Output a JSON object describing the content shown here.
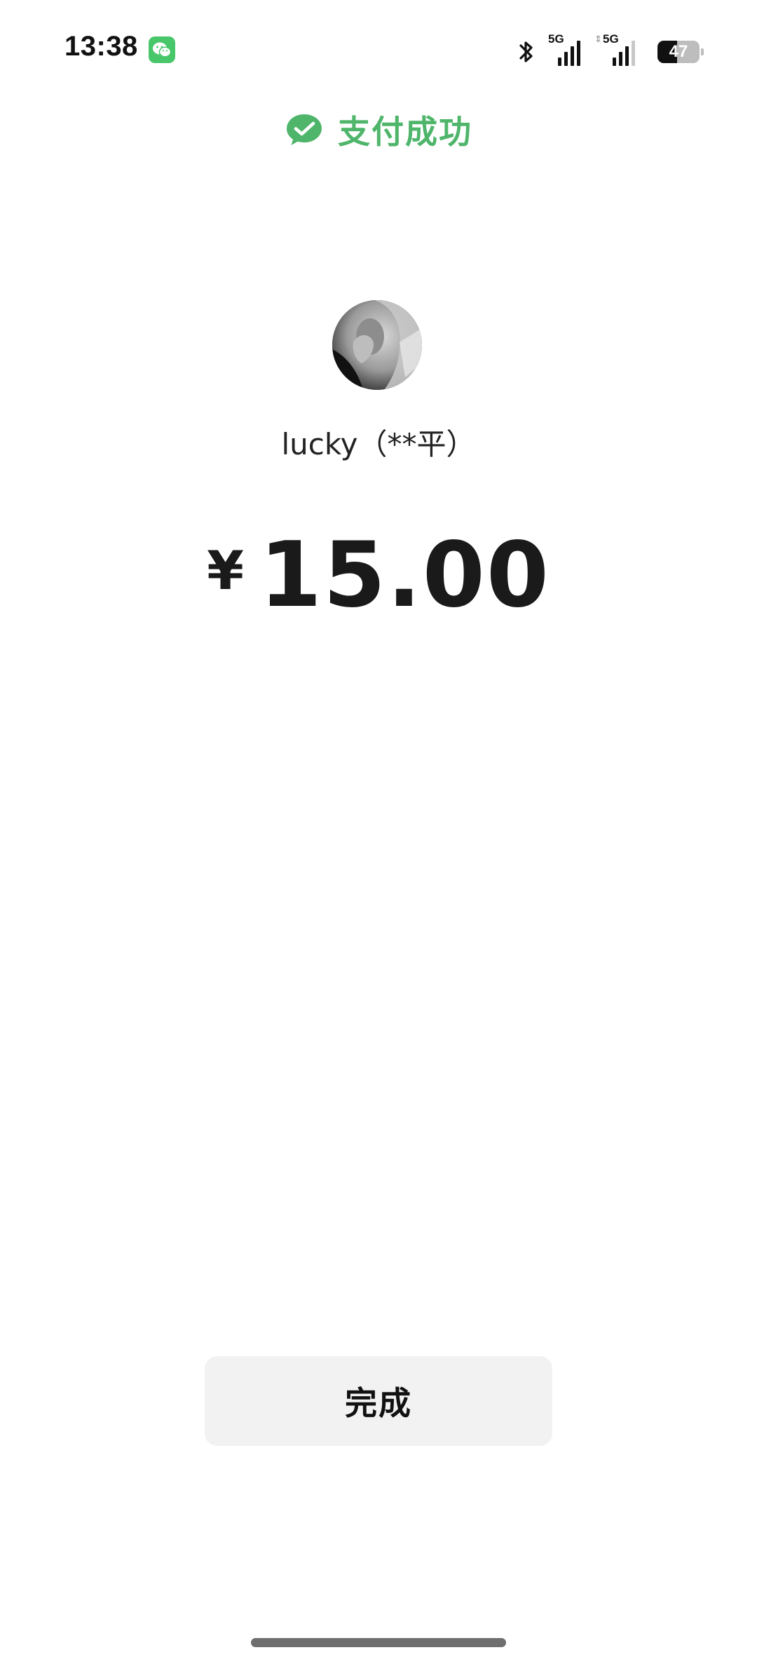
{
  "status_bar": {
    "time": "13:38",
    "app_icon": "wechat-icon",
    "bluetooth_icon": "bluetooth-icon",
    "signal_1": {
      "generation": "5G",
      "level": 4,
      "max_level": 4
    },
    "signal_2": {
      "generation": "5G",
      "level": 3,
      "max_level": 4
    },
    "battery": {
      "percent": 47,
      "label": "47"
    }
  },
  "header": {
    "icon": "wechat-pay-check-icon",
    "title": "支付成功",
    "title_color": "#4fb56b"
  },
  "payee": {
    "avatar": "payee-avatar",
    "name": "lucky（**平）"
  },
  "payment": {
    "currency_symbol": "¥",
    "amount": "15.00"
  },
  "actions": {
    "done_label": "完成"
  }
}
